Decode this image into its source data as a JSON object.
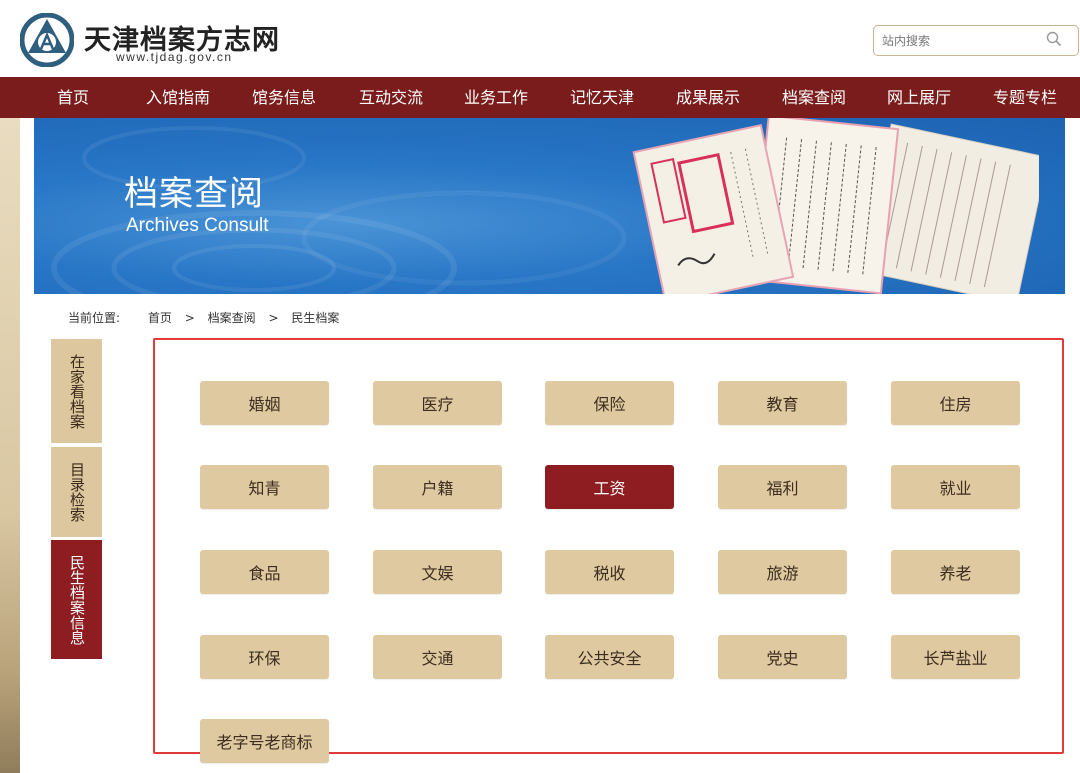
{
  "site": {
    "title": "天津档案方志网",
    "url": "www.tjdag.gov.cn"
  },
  "search": {
    "placeholder": "站内搜索",
    "icon": "search-icon"
  },
  "nav": {
    "items": [
      "首页",
      "入馆指南",
      "馆务信息",
      "互动交流",
      "业务工作",
      "记忆天津",
      "成果展示",
      "档案查阅",
      "网上展厅",
      "专题专栏"
    ]
  },
  "banner": {
    "title": "档案查阅",
    "subtitle": "Archives Consult"
  },
  "breadcrumb": {
    "label": "当前位置:",
    "items": [
      "首页",
      "档案查阅",
      "民生档案"
    ],
    "separator": ">"
  },
  "sidebar": {
    "items": [
      {
        "label": "在家看档案",
        "active": false
      },
      {
        "label": "目录检索",
        "active": false
      },
      {
        "label": "民生档案信息",
        "active": true
      }
    ]
  },
  "categories": {
    "items": [
      {
        "label": "婚姻",
        "active": false
      },
      {
        "label": "医疗",
        "active": false
      },
      {
        "label": "保险",
        "active": false
      },
      {
        "label": "教育",
        "active": false
      },
      {
        "label": "住房",
        "active": false
      },
      {
        "label": "知青",
        "active": false
      },
      {
        "label": "户籍",
        "active": false
      },
      {
        "label": "工资",
        "active": true
      },
      {
        "label": "福利",
        "active": false
      },
      {
        "label": "就业",
        "active": false
      },
      {
        "label": "食品",
        "active": false
      },
      {
        "label": "文娱",
        "active": false
      },
      {
        "label": "税收",
        "active": false
      },
      {
        "label": "旅游",
        "active": false
      },
      {
        "label": "养老",
        "active": false
      },
      {
        "label": "环保",
        "active": false
      },
      {
        "label": "交通",
        "active": false
      },
      {
        "label": "公共安全",
        "active": false
      },
      {
        "label": "党史",
        "active": false
      },
      {
        "label": "长芦盐业",
        "active": false
      },
      {
        "label": "老字号老商标",
        "active": false
      }
    ]
  },
  "colors": {
    "nav_bg": "#7b1c1c",
    "accent": "#8e1d22",
    "button_bg": "#dfc9a0",
    "banner_blue": "#1d63b2",
    "highlight_frame": "#e03a3a"
  }
}
